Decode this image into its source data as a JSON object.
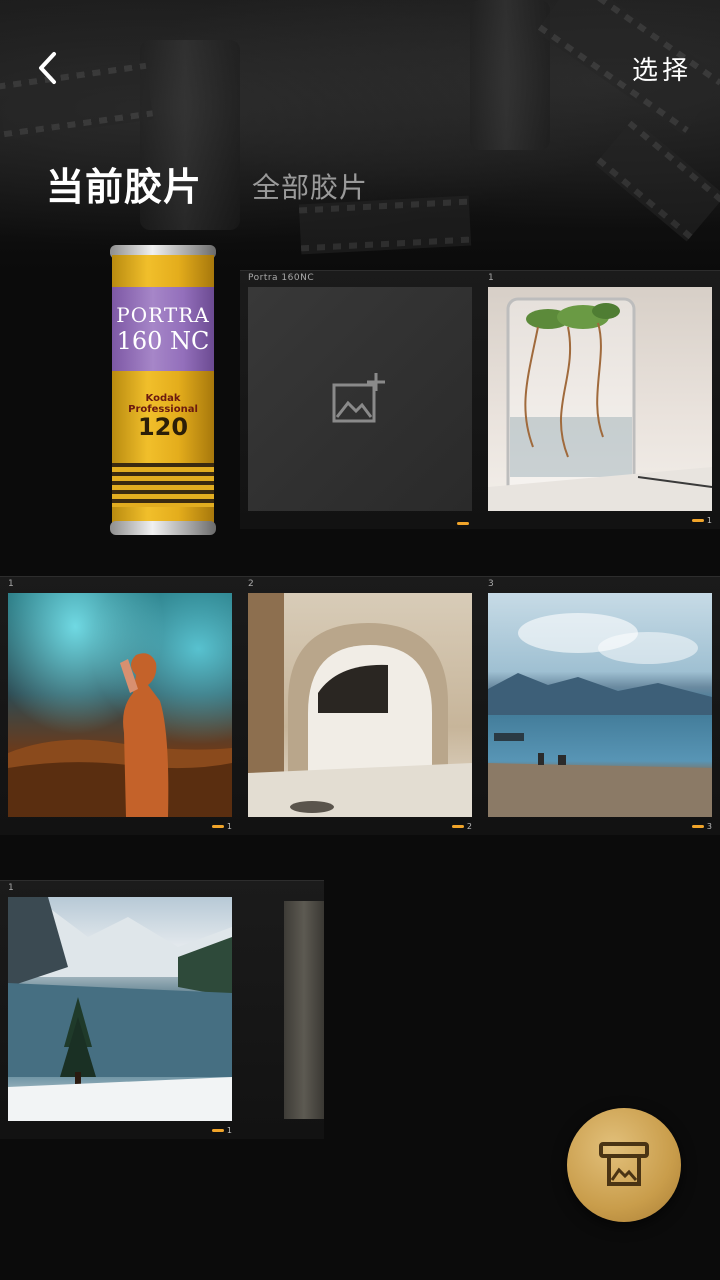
{
  "header": {
    "back_icon": "chevron-left-icon",
    "select_label": "选择",
    "tabs": [
      {
        "label": "当前胶片",
        "active": true
      },
      {
        "label": "全部胶片",
        "active": false
      }
    ]
  },
  "film_can": {
    "brand_line1": "PORTRA",
    "brand_line2": "160 NC",
    "maker": "Kodak Professional",
    "format": "120",
    "colors": {
      "body": "#e8b226",
      "label": "#9b78c0"
    }
  },
  "frames": [
    {
      "label": "Portra 160NC",
      "number": "",
      "content": "add-photo-icon"
    },
    {
      "label": "1",
      "number": "1",
      "content": "photo"
    },
    {
      "label": "1",
      "number": "1",
      "content": "photo"
    },
    {
      "label": "2",
      "number": "2",
      "content": "photo"
    },
    {
      "label": "3",
      "number": "3",
      "content": "photo"
    },
    {
      "label": "1",
      "number": "1",
      "content": "photo"
    }
  ],
  "fab": {
    "icon": "print-photo-icon",
    "color": "#c9a052"
  },
  "accent": "#f0a42a"
}
